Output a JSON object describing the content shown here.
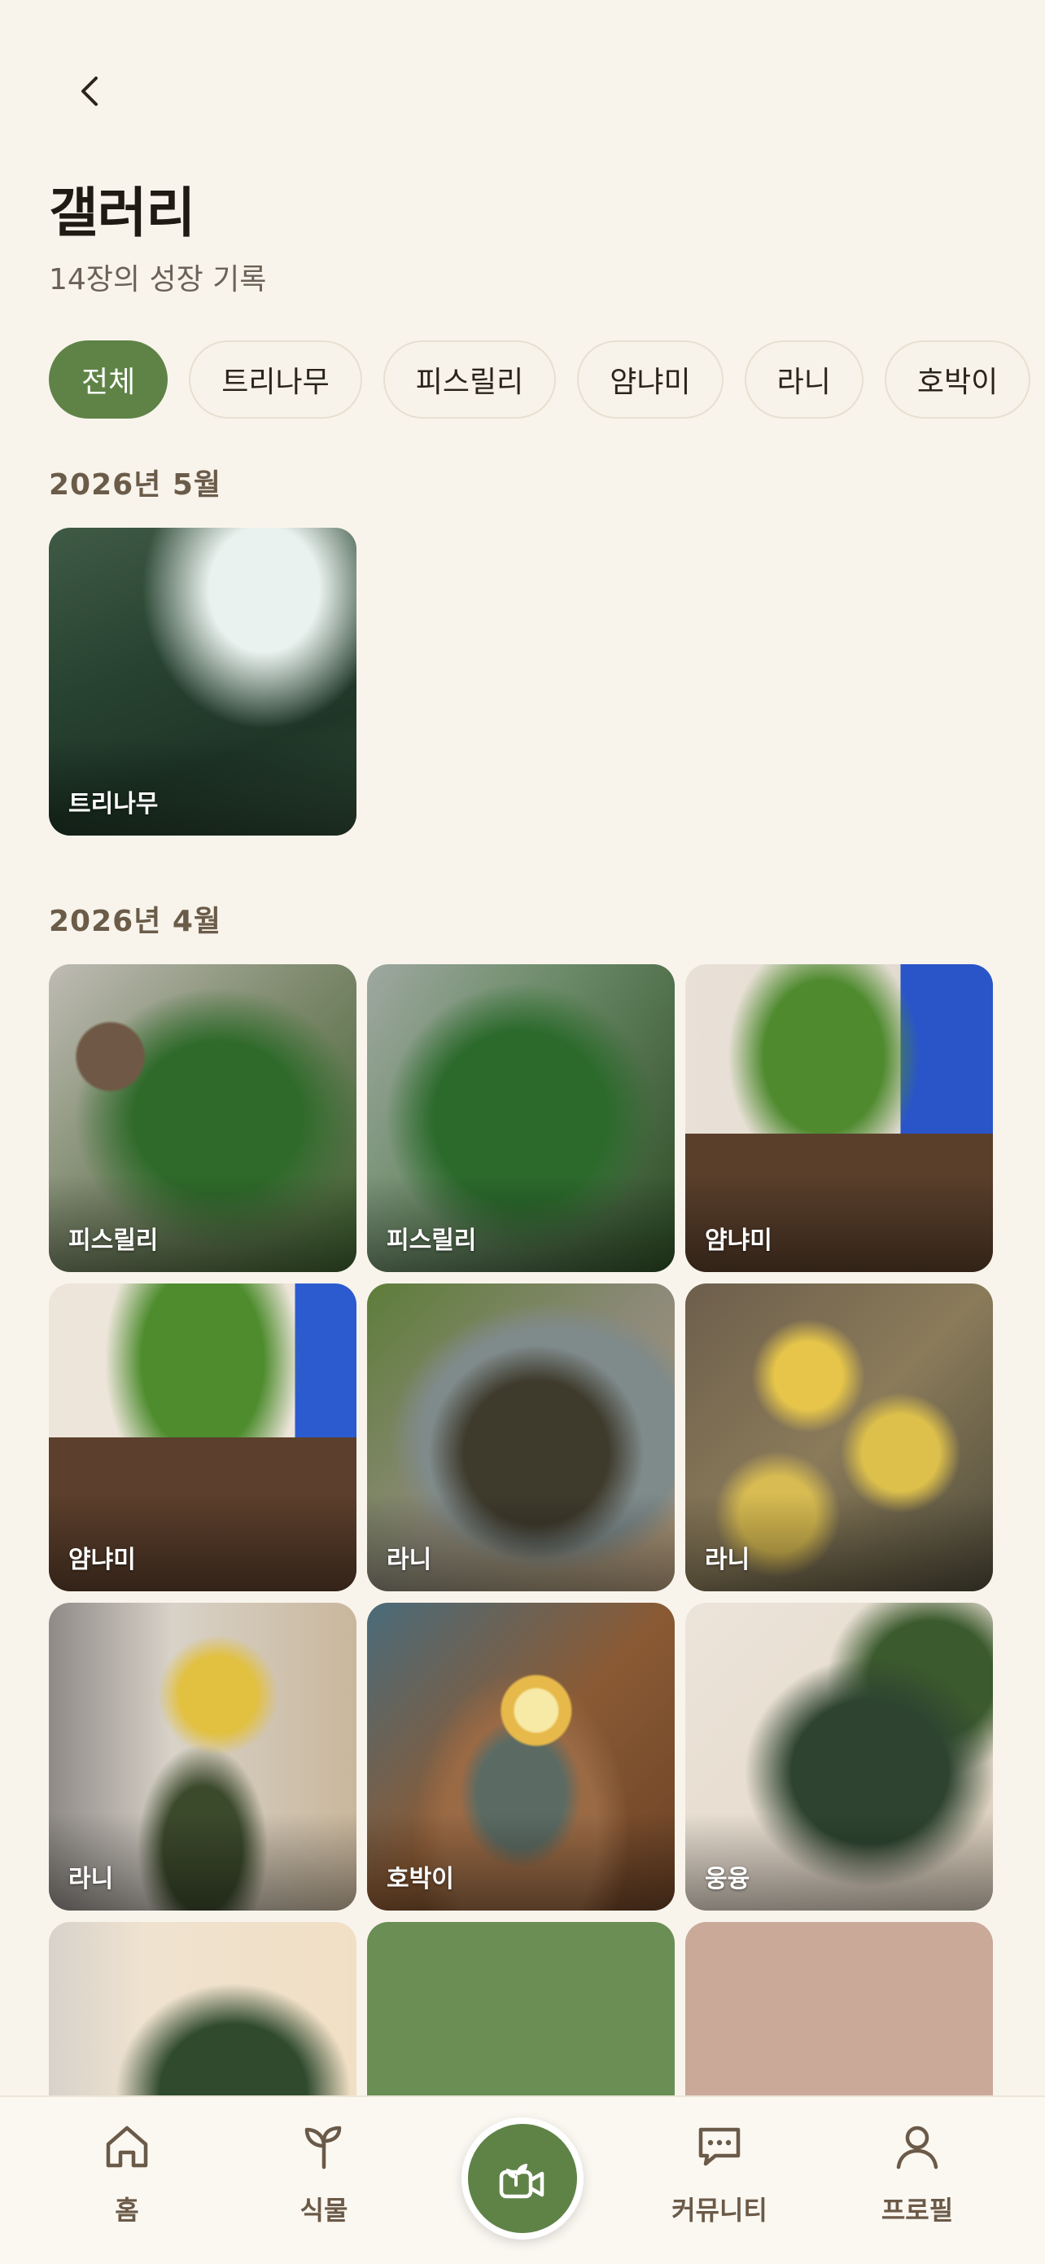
{
  "header": {
    "title": "갤러리",
    "subtitle": "14장의 성장 기록"
  },
  "filters": [
    {
      "label": "전체",
      "active": true
    },
    {
      "label": "트리나무",
      "active": false
    },
    {
      "label": "피스릴리",
      "active": false
    },
    {
      "label": "얌냐미",
      "active": false
    },
    {
      "label": "라니",
      "active": false
    },
    {
      "label": "호박이",
      "active": false
    },
    {
      "label": "",
      "active": false
    }
  ],
  "sections": [
    {
      "heading": "2026년 5월",
      "photos": [
        {
          "label": "트리나무"
        }
      ]
    },
    {
      "heading": "2026년 4월",
      "photos": [
        {
          "label": "피스릴리"
        },
        {
          "label": "피스릴리"
        },
        {
          "label": "얌냐미"
        },
        {
          "label": "얌냐미"
        },
        {
          "label": "라니"
        },
        {
          "label": "라니"
        },
        {
          "label": "라니"
        },
        {
          "label": "호박이"
        },
        {
          "label": "웅융"
        },
        {
          "label": ""
        },
        {
          "label": ""
        },
        {
          "label": ""
        }
      ]
    }
  ],
  "nav": {
    "home": "홈",
    "plants": "식물",
    "community": "커뮤니티",
    "profile": "프로필",
    "center_icon": "camera-plant-icon"
  },
  "colors": {
    "background": "#f8f4ec",
    "accent": "#5f8347",
    "section_heading": "#6b5c49",
    "nav_label": "#6b5a48"
  }
}
